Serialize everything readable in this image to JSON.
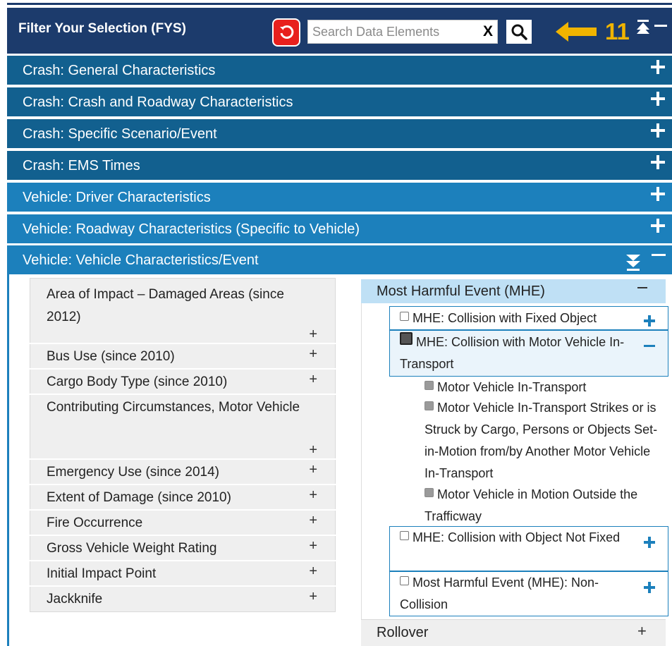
{
  "header": {
    "title": "Filter Your Selection (FYS)",
    "search_placeholder": "Search Data Elements",
    "clear_label": "X",
    "step_number": "11",
    "colors": {
      "bar": "#1c3b6c",
      "reset": "#e8201d",
      "step": "#f0b400"
    },
    "icons": [
      "reset-icon",
      "search-icon",
      "left-arrow-icon",
      "collapse-all-icon",
      "minimize-icon"
    ]
  },
  "accordion": [
    {
      "label": "Crash: General Characteristics"
    },
    {
      "label": "Crash: Crash and Roadway Characteristics"
    },
    {
      "label": "Crash: Specific Scenario/Event"
    },
    {
      "label": "Crash: EMS Times"
    },
    {
      "label": "Vehicle: Driver Characteristics"
    },
    {
      "label": "Vehicle: Roadway Characteristics (Specific to Vehicle)"
    },
    {
      "label": "Vehicle: Vehicle Characteristics/Event"
    }
  ],
  "left_list": {
    "items": [
      {
        "label": "Area of Impact – Damaged Areas (since 2012)"
      },
      {
        "label": "Bus Use (since 2010)"
      },
      {
        "label": "Cargo Body Type (since 2010)"
      },
      {
        "label": "Contributing Circumstances, Motor Vehicle"
      },
      {
        "label": "Emergency Use (since 2014)"
      },
      {
        "label": "Extent of Damage (since 2010)"
      },
      {
        "label": "Fire Occurrence"
      },
      {
        "label": "Gross Vehicle Weight Rating"
      },
      {
        "label": "Initial Impact Point"
      },
      {
        "label": "Jackknife"
      }
    ],
    "plus": "+"
  },
  "right": {
    "group_title": "Most Harmful Event (MHE)",
    "group_minus": "−",
    "options": [
      {
        "label": "MHE: Collision with Fixed Object",
        "checked": false,
        "expanded": false
      },
      {
        "label": "MHE: Collision with Motor Vehicle In-Transport",
        "checked": true,
        "expanded": true
      },
      {
        "label": "MHE: Collision with Object Not Fixed",
        "checked": false,
        "expanded": false
      },
      {
        "label": "Most Harmful Event (MHE): Non-Collision",
        "checked": false,
        "expanded": false
      }
    ],
    "sub_options": [
      {
        "label": "Motor Vehicle In-Transport",
        "checked": true
      },
      {
        "label": "Motor Vehicle In-Transport Strikes or is Struck by Cargo, Persons or Objects Set-in-Motion from/by Another Motor Vehicle In-Transport",
        "checked": true
      },
      {
        "label": "Motor Vehicle in Motion Outside the Trafficway",
        "checked": true
      }
    ],
    "next_group": "Rollover",
    "next_plus": "+"
  }
}
